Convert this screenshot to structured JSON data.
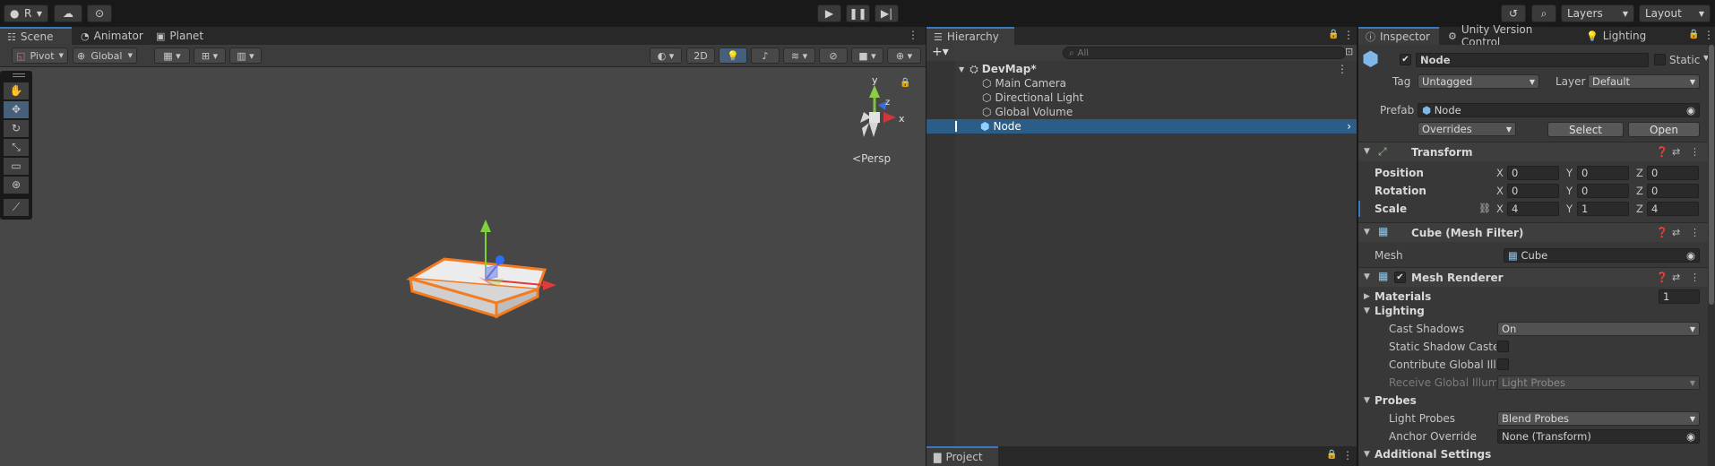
{
  "topbar": {
    "account_label": "R",
    "layers_label": "Layers",
    "layout_label": "Layout"
  },
  "scene_tabs": [
    {
      "label": "Scene",
      "icon": "scene-icon"
    },
    {
      "label": "Animator",
      "icon": "animator-icon"
    },
    {
      "label": "Planet",
      "icon": "planet-icon"
    }
  ],
  "scene_toolbar": {
    "pivot_label": "Pivot",
    "global_label": "Global",
    "mode_2d_label": "2D"
  },
  "scene_view": {
    "persp_label": "Persp",
    "gizmo_axes": {
      "y": "y",
      "z": "z",
      "x": "x"
    }
  },
  "hierarchy": {
    "tab_label": "Hierarchy",
    "search_placeholder": "All",
    "scene_name": "DevMap*",
    "items": [
      {
        "label": "Main Camera"
      },
      {
        "label": "Directional Light"
      },
      {
        "label": "Global Volume"
      },
      {
        "label": "Node"
      }
    ]
  },
  "project_tab": {
    "label": "Project"
  },
  "inspector": {
    "tabs": [
      {
        "label": "Inspector"
      },
      {
        "label": "Unity Version Control"
      },
      {
        "label": "Lighting"
      }
    ],
    "object_name": "Node",
    "static_label": "Static",
    "tag_label": "Tag",
    "tag_value": "Untagged",
    "layer_label": "Layer",
    "layer_value": "Default",
    "prefab_label": "Prefab",
    "prefab_value": "Node",
    "overrides_label": "Overrides",
    "select_label": "Select",
    "open_label": "Open",
    "transform": {
      "title": "Transform",
      "position_label": "Position",
      "rotation_label": "Rotation",
      "scale_label": "Scale",
      "position": {
        "x": "0",
        "y": "0",
        "z": "0"
      },
      "rotation": {
        "x": "0",
        "y": "0",
        "z": "0"
      },
      "scale": {
        "x": "4",
        "y": "1",
        "z": "4"
      },
      "axis_x": "X",
      "axis_y": "Y",
      "axis_z": "Z"
    },
    "mesh_filter": {
      "title": "Cube (Mesh Filter)",
      "mesh_label": "Mesh",
      "mesh_value": "Cube"
    },
    "mesh_renderer": {
      "title": "Mesh Renderer",
      "materials_label": "Materials",
      "materials_count": "1",
      "lighting_label": "Lighting",
      "cast_shadows_label": "Cast Shadows",
      "cast_shadows_value": "On",
      "static_shadow_label": "Static Shadow Caste",
      "contribute_gi_label": "Contribute Global Illu",
      "receive_gi_label": "Receive Global Illumi",
      "receive_gi_value": "Light Probes",
      "probes_label": "Probes",
      "light_probes_label": "Light Probes",
      "light_probes_value": "Blend Probes",
      "anchor_override_label": "Anchor Override",
      "anchor_override_value": "None (Transform)",
      "additional_settings_label": "Additional Settings"
    }
  },
  "colors": {
    "accent_blue": "#3a79bb",
    "selection_blue": "#2c5d87",
    "outline_orange": "#f47b20"
  }
}
